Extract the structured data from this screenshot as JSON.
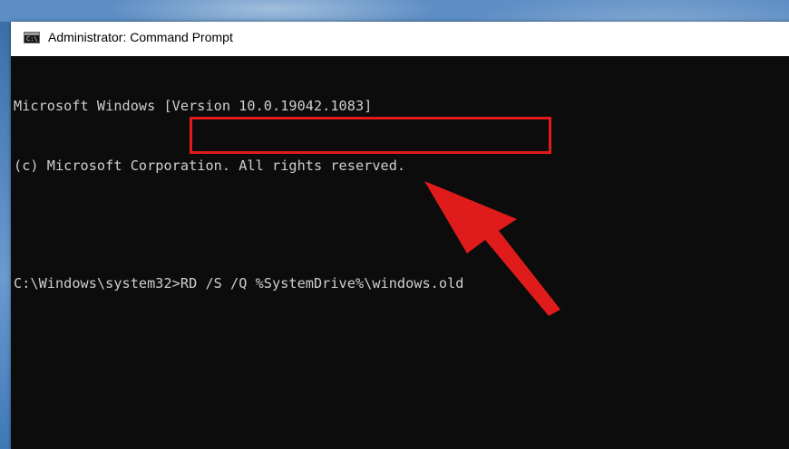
{
  "window": {
    "title": "Administrator: Command Prompt",
    "icon": "cmd-icon"
  },
  "console": {
    "lines": [
      "Microsoft Windows [Version 10.0.19042.1083]",
      "(c) Microsoft Corporation. All rights reserved."
    ],
    "prompt": "C:\\Windows\\system32>",
    "command": "RD /S /Q %SystemDrive%\\windows.old"
  },
  "annotation": {
    "highlight_color": "#e01b1b",
    "arrow_color": "#e01b1b",
    "arrow_icon": "red-arrow-icon"
  }
}
